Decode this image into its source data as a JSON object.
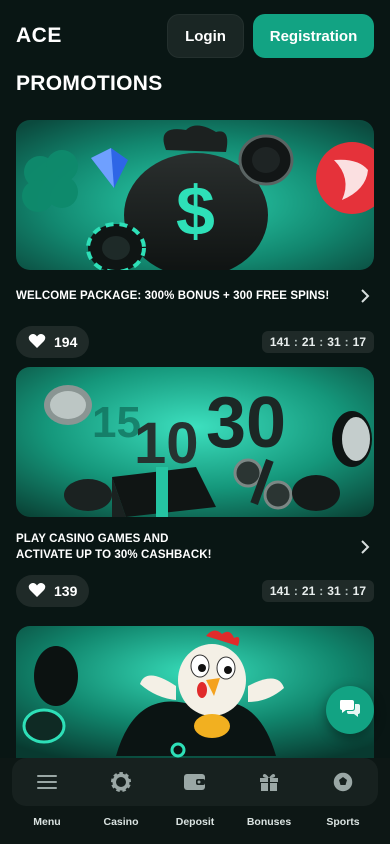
{
  "app": {
    "logo": "ACE"
  },
  "header": {
    "login_label": "Login",
    "registration_label": "Registration"
  },
  "page": {
    "title": "PROMOTIONS"
  },
  "promotions": [
    {
      "title": "WELCOME PACKAGE: 300% BONUS + 300 FREE SPINS!",
      "likes": "194",
      "timer": {
        "d": "141",
        "h": "21",
        "m": "31",
        "s": "17"
      }
    },
    {
      "title": "PLAY CASINO GAMES AND ACTIVATE UP TO 30% CASHBACK!",
      "likes": "139",
      "timer": {
        "d": "141",
        "h": "21",
        "m": "31",
        "s": "17"
      }
    },
    {
      "title": "",
      "likes": "",
      "timer": null
    }
  ],
  "timer_separator": ":",
  "banner2_digits": {
    "a": "15",
    "b": "30",
    "c": "10"
  },
  "nav": {
    "items": [
      {
        "label": "Menu",
        "icon": "menu-icon"
      },
      {
        "label": "Casino",
        "icon": "casino-chip-icon"
      },
      {
        "label": "Deposit",
        "icon": "wallet-icon"
      },
      {
        "label": "Bonuses",
        "icon": "gift-icon"
      },
      {
        "label": "Sports",
        "icon": "soccer-ball-icon"
      }
    ]
  },
  "colors": {
    "background": "#091614",
    "accent": "#12a383",
    "surface": "#1f2a28",
    "banner_teal": "#19a68a"
  }
}
